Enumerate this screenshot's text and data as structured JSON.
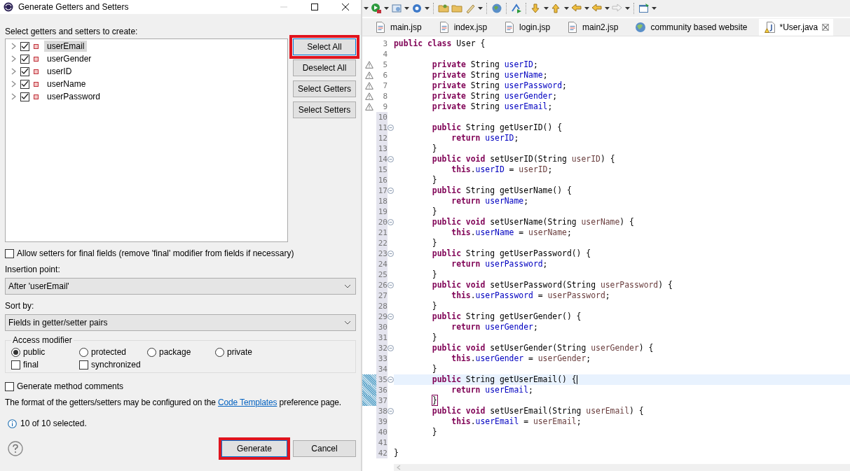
{
  "dialog": {
    "title": "Generate Getters and Setters",
    "prompt": "Select getters and setters to create:",
    "fields": [
      {
        "label": "userEmail",
        "checked": true,
        "selected": true,
        "expanded": false
      },
      {
        "label": "userGender",
        "checked": true,
        "selected": false,
        "expanded": false
      },
      {
        "label": "userID",
        "checked": true,
        "selected": false,
        "expanded": false
      },
      {
        "label": "userName",
        "checked": true,
        "selected": false,
        "expanded": false
      },
      {
        "label": "userPassword",
        "checked": true,
        "selected": false,
        "expanded": false
      }
    ],
    "side_buttons": [
      {
        "label": "Select All",
        "highlighted": true
      },
      {
        "label": "Deselect All",
        "highlighted": false
      },
      {
        "label": "Select Getters",
        "highlighted": false
      },
      {
        "label": "Select Setters",
        "highlighted": false
      }
    ],
    "allow_final_setters": {
      "label": "Allow setters for final fields (remove 'final' modifier from fields if necessary)",
      "checked": false
    },
    "insertion_point": {
      "label": "Insertion point:",
      "value": "After 'userEmail'"
    },
    "sort_by": {
      "label": "Sort by:",
      "value": "Fields in getter/setter pairs"
    },
    "access_modifier": {
      "title": "Access modifier",
      "options": [
        {
          "label": "public",
          "selected": true
        },
        {
          "label": "protected",
          "selected": false
        },
        {
          "label": "package",
          "selected": false
        },
        {
          "label": "private",
          "selected": false
        }
      ],
      "flags": [
        {
          "label": "final",
          "checked": false
        },
        {
          "label": "synchronized",
          "checked": false
        }
      ]
    },
    "method_comments": {
      "label": "Generate method comments",
      "checked": false
    },
    "template_note": {
      "before": "The format of the getters/setters may be configured on the ",
      "link": "Code Templates",
      "after": " preference page."
    },
    "status": "10 of 10 selected.",
    "actions": [
      {
        "label": "Generate",
        "highlighted": true
      },
      {
        "label": "Cancel",
        "highlighted": false
      }
    ]
  },
  "editor": {
    "tabs": [
      {
        "label": "main.jsp",
        "kind": "jsp",
        "selected": false
      },
      {
        "label": "index.jsp",
        "kind": "jsp",
        "selected": false
      },
      {
        "label": "login.jsp",
        "kind": "jsp",
        "selected": false
      },
      {
        "label": "main2.jsp",
        "kind": "jsp",
        "selected": false
      },
      {
        "label": "community based website",
        "kind": "web",
        "selected": false
      },
      {
        "label": "*User.java",
        "kind": "java",
        "selected": true
      }
    ],
    "lines": [
      {
        "n": "3",
        "tokens": [
          {
            "kind": "keyword",
            "text": "public"
          },
          {
            "kind": "keyword",
            "text": " class"
          },
          {
            "kind": "plain",
            "text": " User {"
          }
        ]
      },
      {
        "n": "4"
      },
      {
        "n": "5",
        "warning": true,
        "tokens": [
          {
            "kind": "keyword",
            "text": "        private"
          },
          {
            "kind": "plain",
            "text": " String "
          },
          {
            "kind": "field",
            "text": "userID"
          },
          {
            "kind": "plain",
            "text": ";"
          }
        ]
      },
      {
        "n": "6",
        "warning": true,
        "tokens": [
          {
            "kind": "keyword",
            "text": "        private"
          },
          {
            "kind": "plain",
            "text": " String "
          },
          {
            "kind": "field",
            "text": "userName"
          },
          {
            "kind": "plain",
            "text": ";"
          }
        ]
      },
      {
        "n": "7",
        "warning": true,
        "tokens": [
          {
            "kind": "keyword",
            "text": "        private"
          },
          {
            "kind": "plain",
            "text": " String "
          },
          {
            "kind": "field",
            "text": "userPassword"
          },
          {
            "kind": "plain",
            "text": ";"
          }
        ]
      },
      {
        "n": "8",
        "warning": true,
        "tokens": [
          {
            "kind": "keyword",
            "text": "        private"
          },
          {
            "kind": "plain",
            "text": " String "
          },
          {
            "kind": "field",
            "text": "userGender"
          },
          {
            "kind": "plain",
            "text": ";"
          }
        ]
      },
      {
        "n": "9",
        "warning": true,
        "tokens": [
          {
            "kind": "keyword",
            "text": "        private"
          },
          {
            "kind": "plain",
            "text": " String "
          },
          {
            "kind": "field",
            "text": "userEmail"
          },
          {
            "kind": "plain",
            "text": ";"
          }
        ]
      },
      {
        "n": "10",
        "changed": true
      },
      {
        "n": "11",
        "changed": true,
        "fold": true,
        "tokens": [
          {
            "kind": "keyword",
            "text": "        public"
          },
          {
            "kind": "plain",
            "text": " String getUserID() {"
          }
        ]
      },
      {
        "n": "12",
        "changed": true,
        "tokens": [
          {
            "kind": "keyword",
            "text": "            return"
          },
          {
            "kind": "field",
            "text": " userID"
          },
          {
            "kind": "plain",
            "text": ";"
          }
        ]
      },
      {
        "n": "13",
        "changed": true,
        "tokens": [
          {
            "kind": "plain",
            "text": "        }"
          }
        ]
      },
      {
        "n": "14",
        "changed": true,
        "fold": true,
        "tokens": [
          {
            "kind": "keyword",
            "text": "        public"
          },
          {
            "kind": "keyword",
            "text": " void"
          },
          {
            "kind": "plain",
            "text": " setUserID(String "
          },
          {
            "kind": "parameter",
            "text": "userID"
          },
          {
            "kind": "plain",
            "text": ") {"
          }
        ]
      },
      {
        "n": "15",
        "changed": true,
        "tokens": [
          {
            "kind": "keyword",
            "text": "            this"
          },
          {
            "kind": "plain",
            "text": "."
          },
          {
            "kind": "field",
            "text": "userID"
          },
          {
            "kind": "plain",
            "text": " = "
          },
          {
            "kind": "parameter",
            "text": "userID"
          },
          {
            "kind": "plain",
            "text": ";"
          }
        ]
      },
      {
        "n": "16",
        "changed": true,
        "tokens": [
          {
            "kind": "plain",
            "text": "        }"
          }
        ]
      },
      {
        "n": "17",
        "changed": true,
        "fold": true,
        "tokens": [
          {
            "kind": "keyword",
            "text": "        public"
          },
          {
            "kind": "plain",
            "text": " String getUserName() {"
          }
        ]
      },
      {
        "n": "18",
        "changed": true,
        "tokens": [
          {
            "kind": "keyword",
            "text": "            return"
          },
          {
            "kind": "field",
            "text": " userName"
          },
          {
            "kind": "plain",
            "text": ";"
          }
        ]
      },
      {
        "n": "19",
        "changed": true,
        "tokens": [
          {
            "kind": "plain",
            "text": "        }"
          }
        ]
      },
      {
        "n": "20",
        "changed": true,
        "fold": true,
        "tokens": [
          {
            "kind": "keyword",
            "text": "        public"
          },
          {
            "kind": "keyword",
            "text": " void"
          },
          {
            "kind": "plain",
            "text": " setUserName(String "
          },
          {
            "kind": "parameter",
            "text": "userName"
          },
          {
            "kind": "plain",
            "text": ") {"
          }
        ]
      },
      {
        "n": "21",
        "changed": true,
        "tokens": [
          {
            "kind": "keyword",
            "text": "            this"
          },
          {
            "kind": "plain",
            "text": "."
          },
          {
            "kind": "field",
            "text": "userName"
          },
          {
            "kind": "plain",
            "text": " = "
          },
          {
            "kind": "parameter",
            "text": "userName"
          },
          {
            "kind": "plain",
            "text": ";"
          }
        ]
      },
      {
        "n": "22",
        "changed": true,
        "tokens": [
          {
            "kind": "plain",
            "text": "        }"
          }
        ]
      },
      {
        "n": "23",
        "changed": true,
        "fold": true,
        "tokens": [
          {
            "kind": "keyword",
            "text": "        public"
          },
          {
            "kind": "plain",
            "text": " String getUserPassword() {"
          }
        ]
      },
      {
        "n": "24",
        "changed": true,
        "tokens": [
          {
            "kind": "keyword",
            "text": "            return"
          },
          {
            "kind": "field",
            "text": " userPassword"
          },
          {
            "kind": "plain",
            "text": ";"
          }
        ]
      },
      {
        "n": "25",
        "changed": true,
        "tokens": [
          {
            "kind": "plain",
            "text": "        }"
          }
        ]
      },
      {
        "n": "26",
        "changed": true,
        "fold": true,
        "tokens": [
          {
            "kind": "keyword",
            "text": "        public"
          },
          {
            "kind": "keyword",
            "text": " void"
          },
          {
            "kind": "plain",
            "text": " setUserPassword(String "
          },
          {
            "kind": "parameter",
            "text": "userPassword"
          },
          {
            "kind": "plain",
            "text": ") {"
          }
        ]
      },
      {
        "n": "27",
        "changed": true,
        "tokens": [
          {
            "kind": "keyword",
            "text": "            this"
          },
          {
            "kind": "plain",
            "text": "."
          },
          {
            "kind": "field",
            "text": "userPassword"
          },
          {
            "kind": "plain",
            "text": " = "
          },
          {
            "kind": "parameter",
            "text": "userPassword"
          },
          {
            "kind": "plain",
            "text": ";"
          }
        ]
      },
      {
        "n": "28",
        "changed": true,
        "tokens": [
          {
            "kind": "plain",
            "text": "        }"
          }
        ]
      },
      {
        "n": "29",
        "changed": true,
        "fold": true,
        "tokens": [
          {
            "kind": "keyword",
            "text": "        public"
          },
          {
            "kind": "plain",
            "text": " String getUserGender() {"
          }
        ]
      },
      {
        "n": "30",
        "changed": true,
        "tokens": [
          {
            "kind": "keyword",
            "text": "            return"
          },
          {
            "kind": "field",
            "text": " userGender"
          },
          {
            "kind": "plain",
            "text": ";"
          }
        ]
      },
      {
        "n": "31",
        "changed": true,
        "tokens": [
          {
            "kind": "plain",
            "text": "        }"
          }
        ]
      },
      {
        "n": "32",
        "changed": true,
        "fold": true,
        "tokens": [
          {
            "kind": "keyword",
            "text": "        public"
          },
          {
            "kind": "keyword",
            "text": " void"
          },
          {
            "kind": "plain",
            "text": " setUserGender(String "
          },
          {
            "kind": "parameter",
            "text": "userGender"
          },
          {
            "kind": "plain",
            "text": ") {"
          }
        ]
      },
      {
        "n": "33",
        "changed": true,
        "tokens": [
          {
            "kind": "keyword",
            "text": "            this"
          },
          {
            "kind": "plain",
            "text": "."
          },
          {
            "kind": "field",
            "text": "userGender"
          },
          {
            "kind": "plain",
            "text": " = "
          },
          {
            "kind": "parameter",
            "text": "userGender"
          },
          {
            "kind": "plain",
            "text": ";"
          }
        ]
      },
      {
        "n": "34",
        "changed": true,
        "tokens": [
          {
            "kind": "plain",
            "text": "        }"
          }
        ]
      },
      {
        "n": "35",
        "added": true,
        "fold": true,
        "current": true,
        "tokens": [
          {
            "kind": "keyword",
            "text": "        public"
          },
          {
            "kind": "plain",
            "text": " String getUserEmail() {"
          }
        ]
      },
      {
        "n": "36",
        "added": true,
        "tokens": [
          {
            "kind": "keyword",
            "text": "            return"
          },
          {
            "kind": "field",
            "text": " userEmail"
          },
          {
            "kind": "plain",
            "text": ";"
          }
        ]
      },
      {
        "n": "37",
        "added": true,
        "tokens": [
          {
            "kind": "matched-bracket",
            "text": "        }"
          }
        ]
      },
      {
        "n": "38",
        "changed": true,
        "fold": true,
        "tokens": [
          {
            "kind": "keyword",
            "text": "        public"
          },
          {
            "kind": "keyword",
            "text": " void"
          },
          {
            "kind": "plain",
            "text": " setUserEmail(String "
          },
          {
            "kind": "parameter",
            "text": "userEmail"
          },
          {
            "kind": "plain",
            "text": ") {"
          }
        ]
      },
      {
        "n": "39",
        "changed": true,
        "tokens": [
          {
            "kind": "keyword",
            "text": "            this"
          },
          {
            "kind": "plain",
            "text": "."
          },
          {
            "kind": "field",
            "text": "userEmail"
          },
          {
            "kind": "plain",
            "text": " = "
          },
          {
            "kind": "parameter",
            "text": "userEmail"
          },
          {
            "kind": "plain",
            "text": ";"
          }
        ]
      },
      {
        "n": "40",
        "changed": true,
        "tokens": [
          {
            "kind": "plain",
            "text": "        }"
          }
        ]
      },
      {
        "n": "41",
        "changed": true
      },
      {
        "n": "42",
        "changed": true,
        "tokens": [
          {
            "kind": "plain",
            "text": "}"
          }
        ]
      }
    ]
  }
}
